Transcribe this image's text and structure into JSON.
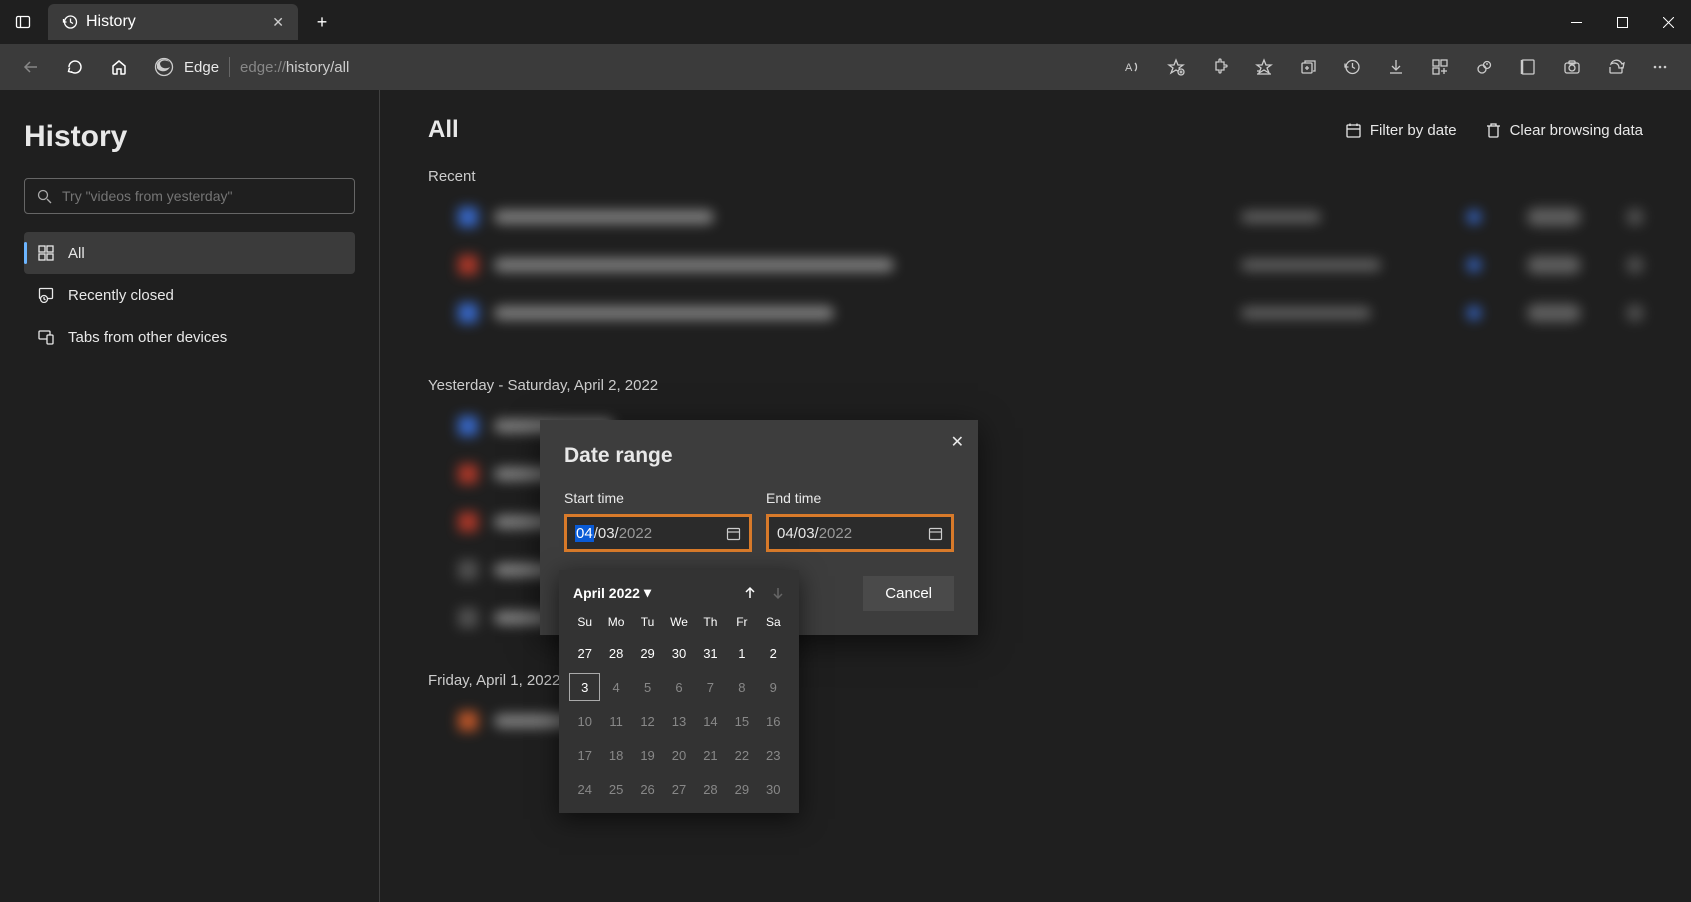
{
  "tab": {
    "title": "History"
  },
  "url": {
    "label": "Edge",
    "prefix": "edge://",
    "path": "history/all"
  },
  "sidebar": {
    "title": "History",
    "search_placeholder": "Try \"videos from yesterday\"",
    "items": [
      {
        "label": "All"
      },
      {
        "label": "Recently closed"
      },
      {
        "label": "Tabs from other devices"
      }
    ]
  },
  "content": {
    "heading": "All",
    "filter_label": "Filter by date",
    "clear_label": "Clear browsing data",
    "sections": [
      "Recent",
      "Yesterday - Saturday, April 2, 2022",
      "Friday, April 1, 2022"
    ]
  },
  "dialog": {
    "title": "Date range",
    "start_label": "Start time",
    "end_label": "End time",
    "start_month": "04",
    "start_day": "/03/",
    "start_year": "2022",
    "end_full": "04/03/",
    "end_year": "2022",
    "cancel": "Cancel"
  },
  "calendar": {
    "month": "April 2022",
    "dow": [
      "Su",
      "Mo",
      "Tu",
      "We",
      "Th",
      "Fr",
      "Sa"
    ],
    "weeks": [
      [
        {
          "d": "27",
          "dim": false
        },
        {
          "d": "28",
          "dim": false
        },
        {
          "d": "29",
          "dim": false
        },
        {
          "d": "30",
          "dim": false
        },
        {
          "d": "31",
          "dim": false
        },
        {
          "d": "1",
          "dim": false
        },
        {
          "d": "2",
          "dim": false
        }
      ],
      [
        {
          "d": "3",
          "dim": false,
          "today": true
        },
        {
          "d": "4",
          "dim": true
        },
        {
          "d": "5",
          "dim": true
        },
        {
          "d": "6",
          "dim": true
        },
        {
          "d": "7",
          "dim": true
        },
        {
          "d": "8",
          "dim": true
        },
        {
          "d": "9",
          "dim": true
        }
      ],
      [
        {
          "d": "10",
          "dim": true
        },
        {
          "d": "11",
          "dim": true
        },
        {
          "d": "12",
          "dim": true
        },
        {
          "d": "13",
          "dim": true
        },
        {
          "d": "14",
          "dim": true
        },
        {
          "d": "15",
          "dim": true
        },
        {
          "d": "16",
          "dim": true
        }
      ],
      [
        {
          "d": "17",
          "dim": true
        },
        {
          "d": "18",
          "dim": true
        },
        {
          "d": "19",
          "dim": true
        },
        {
          "d": "20",
          "dim": true
        },
        {
          "d": "21",
          "dim": true
        },
        {
          "d": "22",
          "dim": true
        },
        {
          "d": "23",
          "dim": true
        }
      ],
      [
        {
          "d": "24",
          "dim": true
        },
        {
          "d": "25",
          "dim": true
        },
        {
          "d": "26",
          "dim": true
        },
        {
          "d": "27",
          "dim": true
        },
        {
          "d": "28",
          "dim": true
        },
        {
          "d": "29",
          "dim": true
        },
        {
          "d": "30",
          "dim": true
        }
      ]
    ]
  }
}
